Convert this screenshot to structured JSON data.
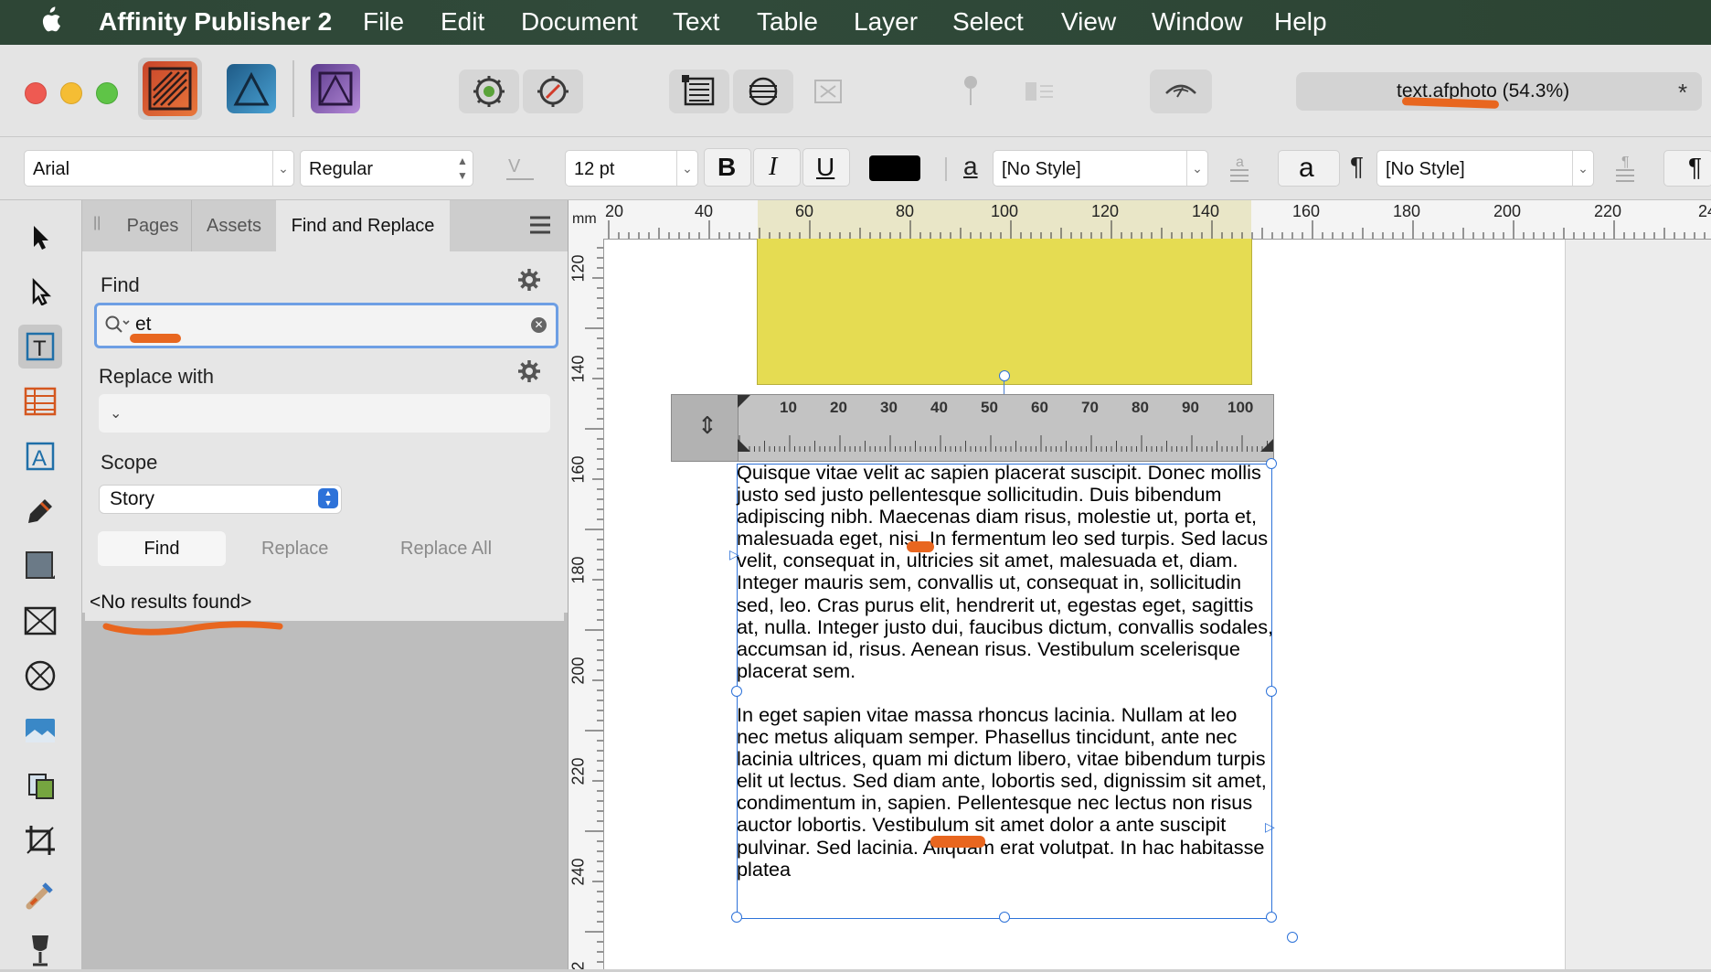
{
  "menubar": {
    "apple_icon": "apple-icon",
    "app_name": "Affinity Publisher 2",
    "items": [
      "File",
      "Edit",
      "Document",
      "Text",
      "Table",
      "Layer",
      "Select",
      "View",
      "Window",
      "Help"
    ]
  },
  "toolbar": {
    "document_title": "text.afphoto (54.3%)",
    "unsaved_marker": "*"
  },
  "context": {
    "font_family": "Arial",
    "font_style": "Regular",
    "font_size": "12 pt",
    "bold": "B",
    "italic": "I",
    "underline": "U",
    "char_style_icon_label": "a",
    "char_style": "[No Style]",
    "char_a_label": "a",
    "para_mark": "¶",
    "para_style": "[No Style]",
    "para_mark_right": "¶"
  },
  "panel": {
    "tabs": [
      "Pages",
      "Assets",
      "Find and Replace"
    ],
    "find_label": "Find",
    "find_value": "et",
    "replace_label": "Replace with",
    "replace_value": "",
    "scope_label": "Scope",
    "scope_value": "Story",
    "buttons": {
      "find": "Find",
      "replace": "Replace",
      "replace_all": "Replace All"
    },
    "results": "<No results found>"
  },
  "rulers": {
    "unit": "mm",
    "h_ticks": [
      "20",
      "40",
      "60",
      "80",
      "100",
      "120",
      "140",
      "160",
      "180",
      "200",
      "220",
      "24"
    ],
    "v_ticks": [
      "120",
      "140",
      "160",
      "180",
      "200",
      "220",
      "240",
      "2"
    ],
    "frame_ticks": [
      "10",
      "20",
      "30",
      "40",
      "50",
      "60",
      "70",
      "80",
      "90",
      "100"
    ]
  },
  "story": {
    "paragraph1": "Quisque vitae velit ac sapien placerat suscipit. Donec mollis justo sed justo pellentesque sollicitudin. Duis bibendum adipiscing nibh. Maecenas diam risus, molestie ut, porta et, malesuada eget, nisi. In fermentum leo sed turpis. Sed lacus velit, consequat in, ultricies sit amet, malesuada et, diam. Integer mauris sem, convallis ut, consequat in, sollicitudin sed, leo. Cras purus elit, hendrerit ut, egestas eget, sagittis at, nulla. Integer justo dui, faucibus dictum, convallis sodales, accumsan id, risus. Aenean risus. Vestibulum scelerisque placerat sem.",
    "paragraph2": "In eget sapien vitae massa rhoncus lacinia. Nullam at leo nec metus aliquam semper. Phasellus tincidunt, ante nec lacinia ultrices, quam mi dictum libero, vitae bibendum turpis elit ut lectus. Sed diam ante, lobortis sed, dignissim sit amet, condimentum in, sapien. Pellentesque nec lectus non risus auctor lobortis. Vestibulum sit amet dolor a ante suscipit pulvinar. Sed lacinia. Aliquam erat volutpat. In hac habitasse platea"
  },
  "colors": {
    "accent": "#2d72d9",
    "annotation": "#e8661f",
    "yellow_frame": "#e5dc52",
    "text_color_swatch": "#000000"
  }
}
